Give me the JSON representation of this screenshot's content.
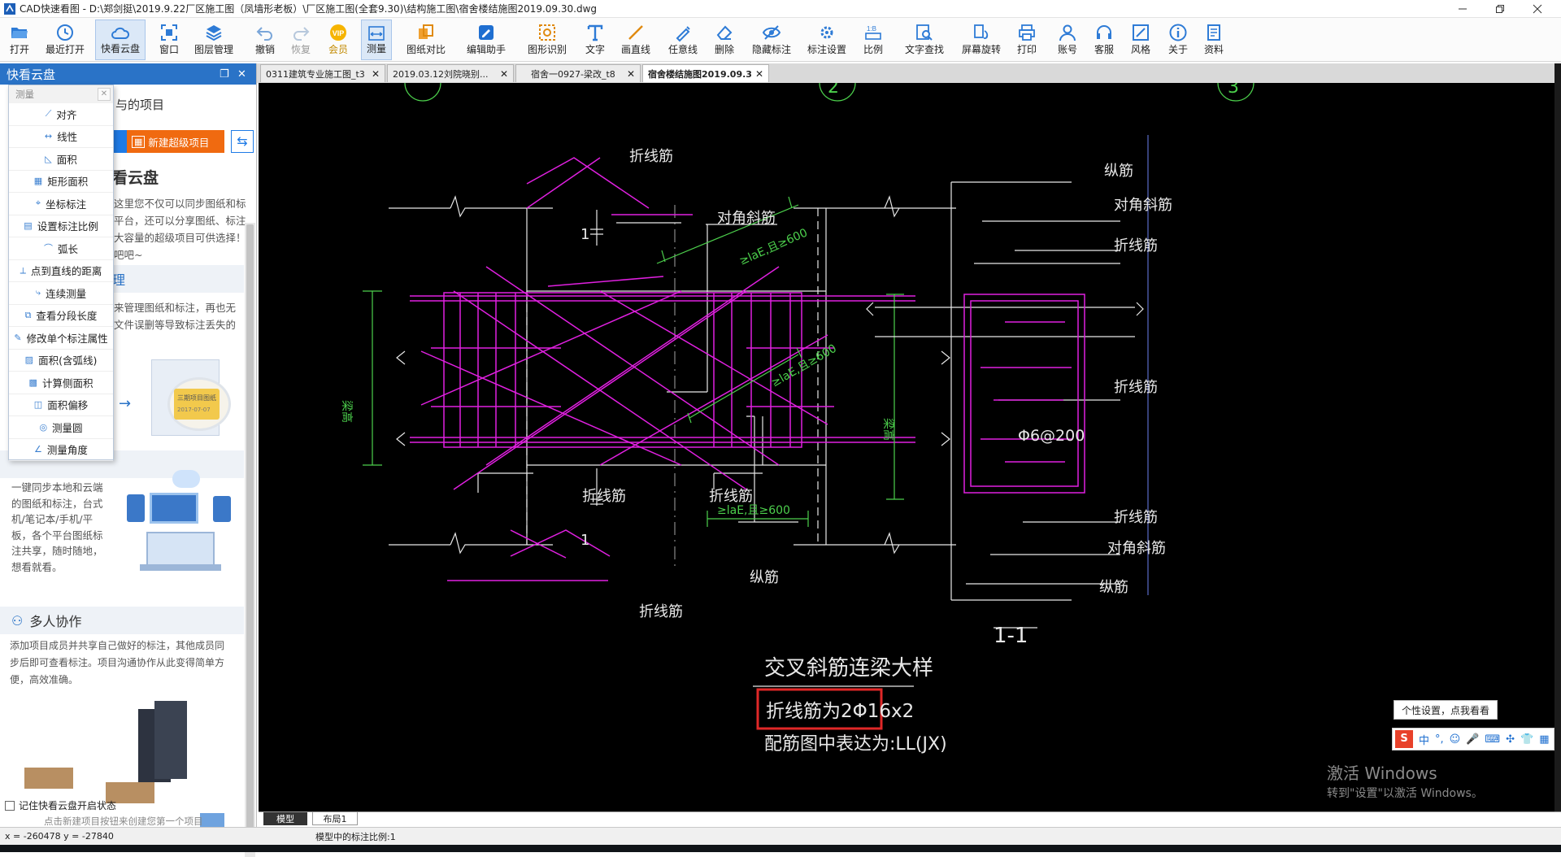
{
  "window": {
    "title": "CAD快速看图 - D:\\郑剑挺\\2019.9.22厂区施工图（凤墙形老板）\\厂区施工图(全套9.30)\\结构施工图\\宿舍楼结施图2019.09.30.dwg"
  },
  "toolbar": {
    "items": [
      {
        "label": "打开",
        "icon": "folder-open-icon"
      },
      {
        "label": "最近打开",
        "icon": "recent-clock-icon"
      },
      {
        "label": "快看云盘",
        "icon": "cloud-icon"
      },
      {
        "label": "窗口",
        "icon": "window-frame-icon"
      },
      {
        "label": "图层管理",
        "icon": "layers-icon"
      },
      {
        "label": "撤销",
        "icon": "undo-icon"
      },
      {
        "label": "恢复",
        "icon": "redo-icon"
      },
      {
        "label": "会员",
        "icon": "vip-badge-icon"
      },
      {
        "label": "测量",
        "icon": "measure-ruler-icon"
      },
      {
        "label": "图纸对比",
        "icon": "compare-icon"
      },
      {
        "label": "编辑助手",
        "icon": "edit-assistant-icon"
      },
      {
        "label": "图形识别",
        "icon": "shape-recognize-icon"
      },
      {
        "label": "文字",
        "icon": "text-t-icon"
      },
      {
        "label": "画直线",
        "icon": "line-icon"
      },
      {
        "label": "任意线",
        "icon": "freehand-pen-icon"
      },
      {
        "label": "删除",
        "icon": "eraser-icon"
      },
      {
        "label": "隐藏标注",
        "icon": "hide-eye-icon"
      },
      {
        "label": "标注设置",
        "icon": "annotation-settings-icon"
      },
      {
        "label": "比例",
        "icon": "scale-icon"
      },
      {
        "label": "文字查找",
        "icon": "text-search-icon"
      },
      {
        "label": "屏幕旋转",
        "icon": "rotate-screen-icon"
      },
      {
        "label": "打印",
        "icon": "printer-icon"
      },
      {
        "label": "账号",
        "icon": "user-icon"
      },
      {
        "label": "客服",
        "icon": "headset-icon"
      },
      {
        "label": "风格",
        "icon": "style-icon"
      },
      {
        "label": "关于",
        "icon": "info-icon"
      },
      {
        "label": "资料",
        "icon": "docs-icon"
      }
    ]
  },
  "doc_tabs": [
    {
      "label": "0311建筑专业施工图_t3"
    },
    {
      "label": "2019.03.12刘院晓别..."
    },
    {
      "label": "宿舍一0927-梁改_t8"
    },
    {
      "label": "宿舍楼结施图2019.09.3"
    }
  ],
  "sidebar": {
    "title": "快看云盘",
    "partial_heading": "与的项目",
    "new_project_button": "新建超级项目",
    "intro_heading": "看云盘",
    "intro_text": [
      "这里您不仅可以同步图纸和标",
      "平台，还可以分享图纸、标注",
      "大容量的超级项目可供选择！",
      "吧吧~"
    ],
    "manage_heading": "理",
    "manage_text": [
      "来管理图纸和标注，再也无",
      "文件误删等导致标注丢失的"
    ],
    "illustration_caption": "三期项目图纸",
    "illustration_date": "2017-07-07",
    "sync_text": [
      "一键同步本地和云端",
      "的图纸和标注，台式",
      "机/笔记本/手机/平",
      "板，各个平台图纸标",
      "注共享，随时随地，",
      "想看就看。"
    ],
    "collab_heading": "多人协作",
    "collab_text": [
      "添加项目成员并共享自己做好的标注，其他成员同",
      "步后即可查看标注。项目沟通协作从此变得简单方",
      "便，高效准确。"
    ],
    "remember_label": "记住快看云盘开启状态",
    "footer_hint": "点击新建项目按钮来创建您第一个项目"
  },
  "measure_menu": {
    "title": "测量",
    "items": [
      "对齐",
      "线性",
      "面积",
      "矩形面积",
      "坐标标注",
      "设置标注比例",
      "弧长",
      "点到直线的距离",
      "连续测量",
      "查看分段长度",
      "修改单个标注属性",
      "面积(含弧线)",
      "计算侧面积",
      "面积偏移",
      "测量圆",
      "测量角度"
    ]
  },
  "drawing": {
    "labels": {
      "zhexian": "折线筋",
      "duijiao": "对角斜筋",
      "zongjin": "纵筋",
      "anchor": "≥laE,且≥600",
      "section_mark": "1",
      "height_label": "梁高",
      "stirrup": "Φ6@200",
      "section_title": "1-1",
      "detail_title": "交叉斜筋连梁大样",
      "note1": "折线筋为2Φ16x2",
      "note2": "配筋图中表达为:LL(JX)",
      "axis_2": "2",
      "axis_3": "3"
    },
    "colors": {
      "magenta": "#e020e0",
      "white": "#e8e8e8",
      "green": "#4cd04c",
      "highlight": "#e02828"
    }
  },
  "layout_tabs": [
    "模型",
    "布局1"
  ],
  "status": {
    "coords": "x = -260478  y = -27840",
    "scale_text": "模型中的标注比例:1"
  },
  "overlay": {
    "tooltip": "个性设置，点我看看",
    "ime_lang": "中",
    "watermark_title": "激活 Windows",
    "watermark_sub": "转到\"设置\"以激活 Windows。"
  }
}
